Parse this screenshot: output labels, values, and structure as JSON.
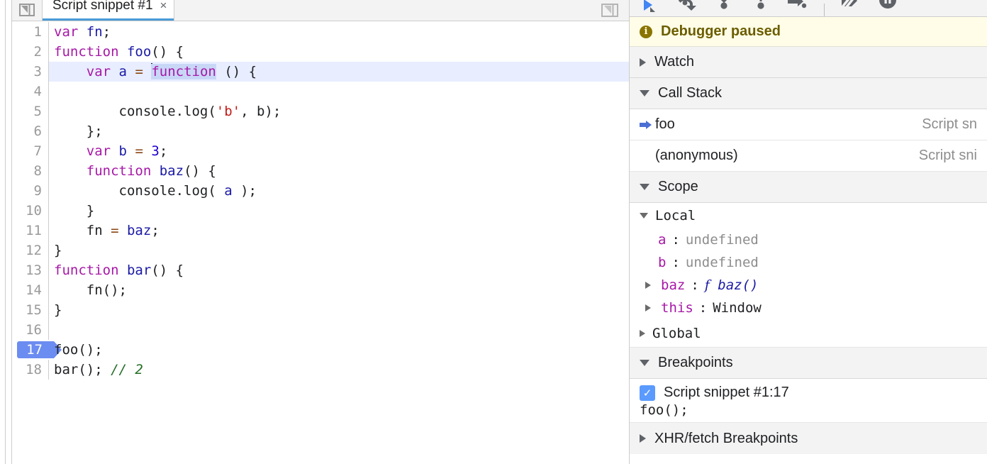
{
  "editor": {
    "panel_icon_name": "dock-panel-icon",
    "right_icon_name": "show-navigator-icon",
    "tab": {
      "title": "Script snippet #1",
      "close_label": "×"
    },
    "lines": [
      {
        "n": "1",
        "tokens": [
          {
            "t": "var",
            "c": "kw"
          },
          {
            "t": " ",
            "c": ""
          },
          {
            "t": "fn",
            "c": "blue"
          },
          {
            "t": ";",
            "c": "ident"
          }
        ]
      },
      {
        "n": "2",
        "tokens": [
          {
            "t": "function",
            "c": "kw"
          },
          {
            "t": " ",
            "c": ""
          },
          {
            "t": "foo",
            "c": "blue"
          },
          {
            "t": "() {",
            "c": "ident"
          }
        ]
      },
      {
        "n": "3",
        "exec": true,
        "tokens": [
          {
            "t": "    ",
            "c": ""
          },
          {
            "t": "var",
            "c": "kw"
          },
          {
            "t": " ",
            "c": ""
          },
          {
            "t": "a",
            "c": "blue"
          },
          {
            "t": " ",
            "c": ""
          },
          {
            "t": "=",
            "c": "op"
          },
          {
            "t": " ",
            "c": ""
          },
          {
            "t": "CARET",
            "c": "caret"
          },
          {
            "t": "function",
            "c": "kw sel"
          },
          {
            "t": " () {",
            "c": "ident"
          }
        ]
      },
      {
        "n": "4",
        "tokens": []
      },
      {
        "n": "5",
        "tokens": [
          {
            "t": "        console.log(",
            "c": "ident"
          },
          {
            "t": "'b'",
            "c": "str"
          },
          {
            "t": ", b);",
            "c": "ident"
          }
        ]
      },
      {
        "n": "6",
        "tokens": [
          {
            "t": "    };",
            "c": "ident"
          }
        ]
      },
      {
        "n": "7",
        "tokens": [
          {
            "t": "    ",
            "c": ""
          },
          {
            "t": "var",
            "c": "kw"
          },
          {
            "t": " ",
            "c": ""
          },
          {
            "t": "b",
            "c": "blue"
          },
          {
            "t": " ",
            "c": ""
          },
          {
            "t": "=",
            "c": "op"
          },
          {
            "t": " ",
            "c": ""
          },
          {
            "t": "3",
            "c": "num"
          },
          {
            "t": ";",
            "c": "ident"
          }
        ]
      },
      {
        "n": "8",
        "tokens": [
          {
            "t": "    ",
            "c": ""
          },
          {
            "t": "function",
            "c": "kw"
          },
          {
            "t": " ",
            "c": ""
          },
          {
            "t": "baz",
            "c": "blue"
          },
          {
            "t": "() {",
            "c": "ident"
          }
        ]
      },
      {
        "n": "9",
        "tokens": [
          {
            "t": "        console.log( ",
            "c": "ident"
          },
          {
            "t": "a",
            "c": "blue"
          },
          {
            "t": " );",
            "c": "ident"
          }
        ]
      },
      {
        "n": "10",
        "tokens": [
          {
            "t": "    }",
            "c": "ident"
          }
        ]
      },
      {
        "n": "11",
        "tokens": [
          {
            "t": "    fn ",
            "c": "ident"
          },
          {
            "t": "=",
            "c": "op"
          },
          {
            "t": " ",
            "c": ""
          },
          {
            "t": "baz",
            "c": "blue"
          },
          {
            "t": ";",
            "c": "ident"
          }
        ]
      },
      {
        "n": "12",
        "tokens": [
          {
            "t": "}",
            "c": "ident"
          }
        ]
      },
      {
        "n": "13",
        "tokens": [
          {
            "t": "function",
            "c": "kw"
          },
          {
            "t": " ",
            "c": ""
          },
          {
            "t": "bar",
            "c": "blue"
          },
          {
            "t": "() {",
            "c": "ident"
          }
        ]
      },
      {
        "n": "14",
        "tokens": [
          {
            "t": "    fn();",
            "c": "ident"
          }
        ]
      },
      {
        "n": "15",
        "tokens": [
          {
            "t": "}",
            "c": "ident"
          }
        ]
      },
      {
        "n": "16",
        "tokens": []
      },
      {
        "n": "17",
        "breakpoint": true,
        "tokens": [
          {
            "t": "foo();",
            "c": "ident"
          }
        ]
      },
      {
        "n": "18",
        "tokens": [
          {
            "t": "bar(); ",
            "c": "ident"
          },
          {
            "t": "// 2",
            "c": "cmt"
          }
        ]
      }
    ]
  },
  "debugger": {
    "toolbar": [
      {
        "name": "resume-script-execution-button",
        "icon": "resume-icon"
      },
      {
        "name": "step-over-next-function-call-button",
        "icon": "step-over-icon"
      },
      {
        "name": "step-into-next-function-call-button",
        "icon": "step-into-icon"
      },
      {
        "name": "step-out-of-current-function-button",
        "icon": "step-out-icon"
      },
      {
        "name": "step-button",
        "icon": "step-icon"
      },
      {
        "name": "toolbar-separator",
        "icon": "separator"
      },
      {
        "name": "deactivate-breakpoints-button",
        "icon": "deactivate-breakpoints-icon"
      },
      {
        "name": "pause-on-exceptions-button",
        "icon": "pause-on-exceptions-icon"
      }
    ],
    "paused_banner": {
      "icon": "info-icon",
      "text": "Debugger paused"
    },
    "watch": {
      "label": "Watch",
      "expanded": false
    },
    "call_stack": {
      "label": "Call Stack",
      "expanded": true,
      "frames": [
        {
          "name": "foo",
          "location": "Script sn",
          "selected": true
        },
        {
          "name": "(anonymous)",
          "location": "Script sni",
          "selected": false
        }
      ]
    },
    "scope": {
      "label": "Scope",
      "expanded": true,
      "local": {
        "label": "Local",
        "expanded": true,
        "properties": [
          {
            "name": "a",
            "sep": ": ",
            "value": "undefined",
            "kind": "undef",
            "expandable": false
          },
          {
            "name": "b",
            "sep": ": ",
            "value": "undefined",
            "kind": "undef",
            "expandable": false
          },
          {
            "name": "baz",
            "sep": ": ",
            "value": "baz()",
            "prefix": "f",
            "kind": "function",
            "expandable": true
          },
          {
            "name": "this",
            "sep": ": ",
            "value": "Window",
            "kind": "object",
            "expandable": true
          }
        ]
      },
      "global": {
        "label": "Global",
        "expanded": false
      }
    },
    "breakpoints": {
      "label": "Breakpoints",
      "expanded": true,
      "items": [
        {
          "checked": true,
          "check_glyph": "✓",
          "title": "Script snippet #1:17",
          "code": "foo();"
        }
      ]
    },
    "xhr_breakpoints": {
      "label": "XHR/fetch Breakpoints",
      "expanded": false
    }
  },
  "annotation": {
    "name": "local-scope-highlight-box",
    "color": "#e8432a"
  }
}
